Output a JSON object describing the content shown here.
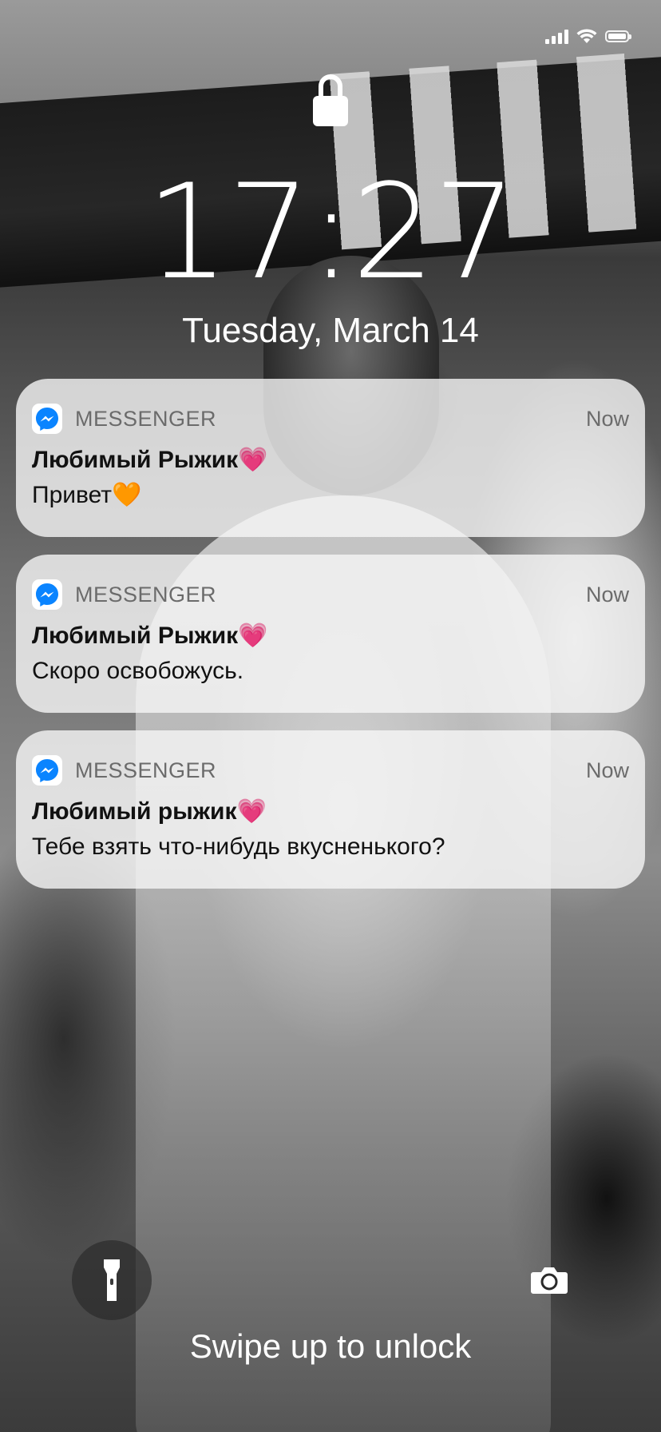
{
  "lock_screen": {
    "time": "17:27",
    "date": "Tuesday, March 14",
    "unlock_hint": "Swipe up to unlock"
  },
  "status_bar": {
    "icons": [
      "signal-icon",
      "wifi-icon",
      "battery-icon"
    ]
  },
  "notifications": [
    {
      "app": "MESSENGER",
      "time": "Now",
      "title": "Любимый Рыжик",
      "title_emoji": "💗",
      "message": "Привет",
      "message_emoji": "🧡"
    },
    {
      "app": "MESSENGER",
      "time": "Now",
      "title": "Любимый Рыжик",
      "title_emoji": "💗",
      "message": "Скоро освобожусь.",
      "message_emoji": ""
    },
    {
      "app": "MESSENGER",
      "time": "Now",
      "title": "Любимый рыжик",
      "title_emoji": "💗",
      "message": "Тебе взять что-нибудь вкусненького?",
      "message_emoji": ""
    }
  ],
  "controls": {
    "left": "flashlight-icon",
    "right": "camera-icon"
  },
  "colors": {
    "messenger_blue": "#0a84ff",
    "notification_bg": "#f6f6f6"
  }
}
